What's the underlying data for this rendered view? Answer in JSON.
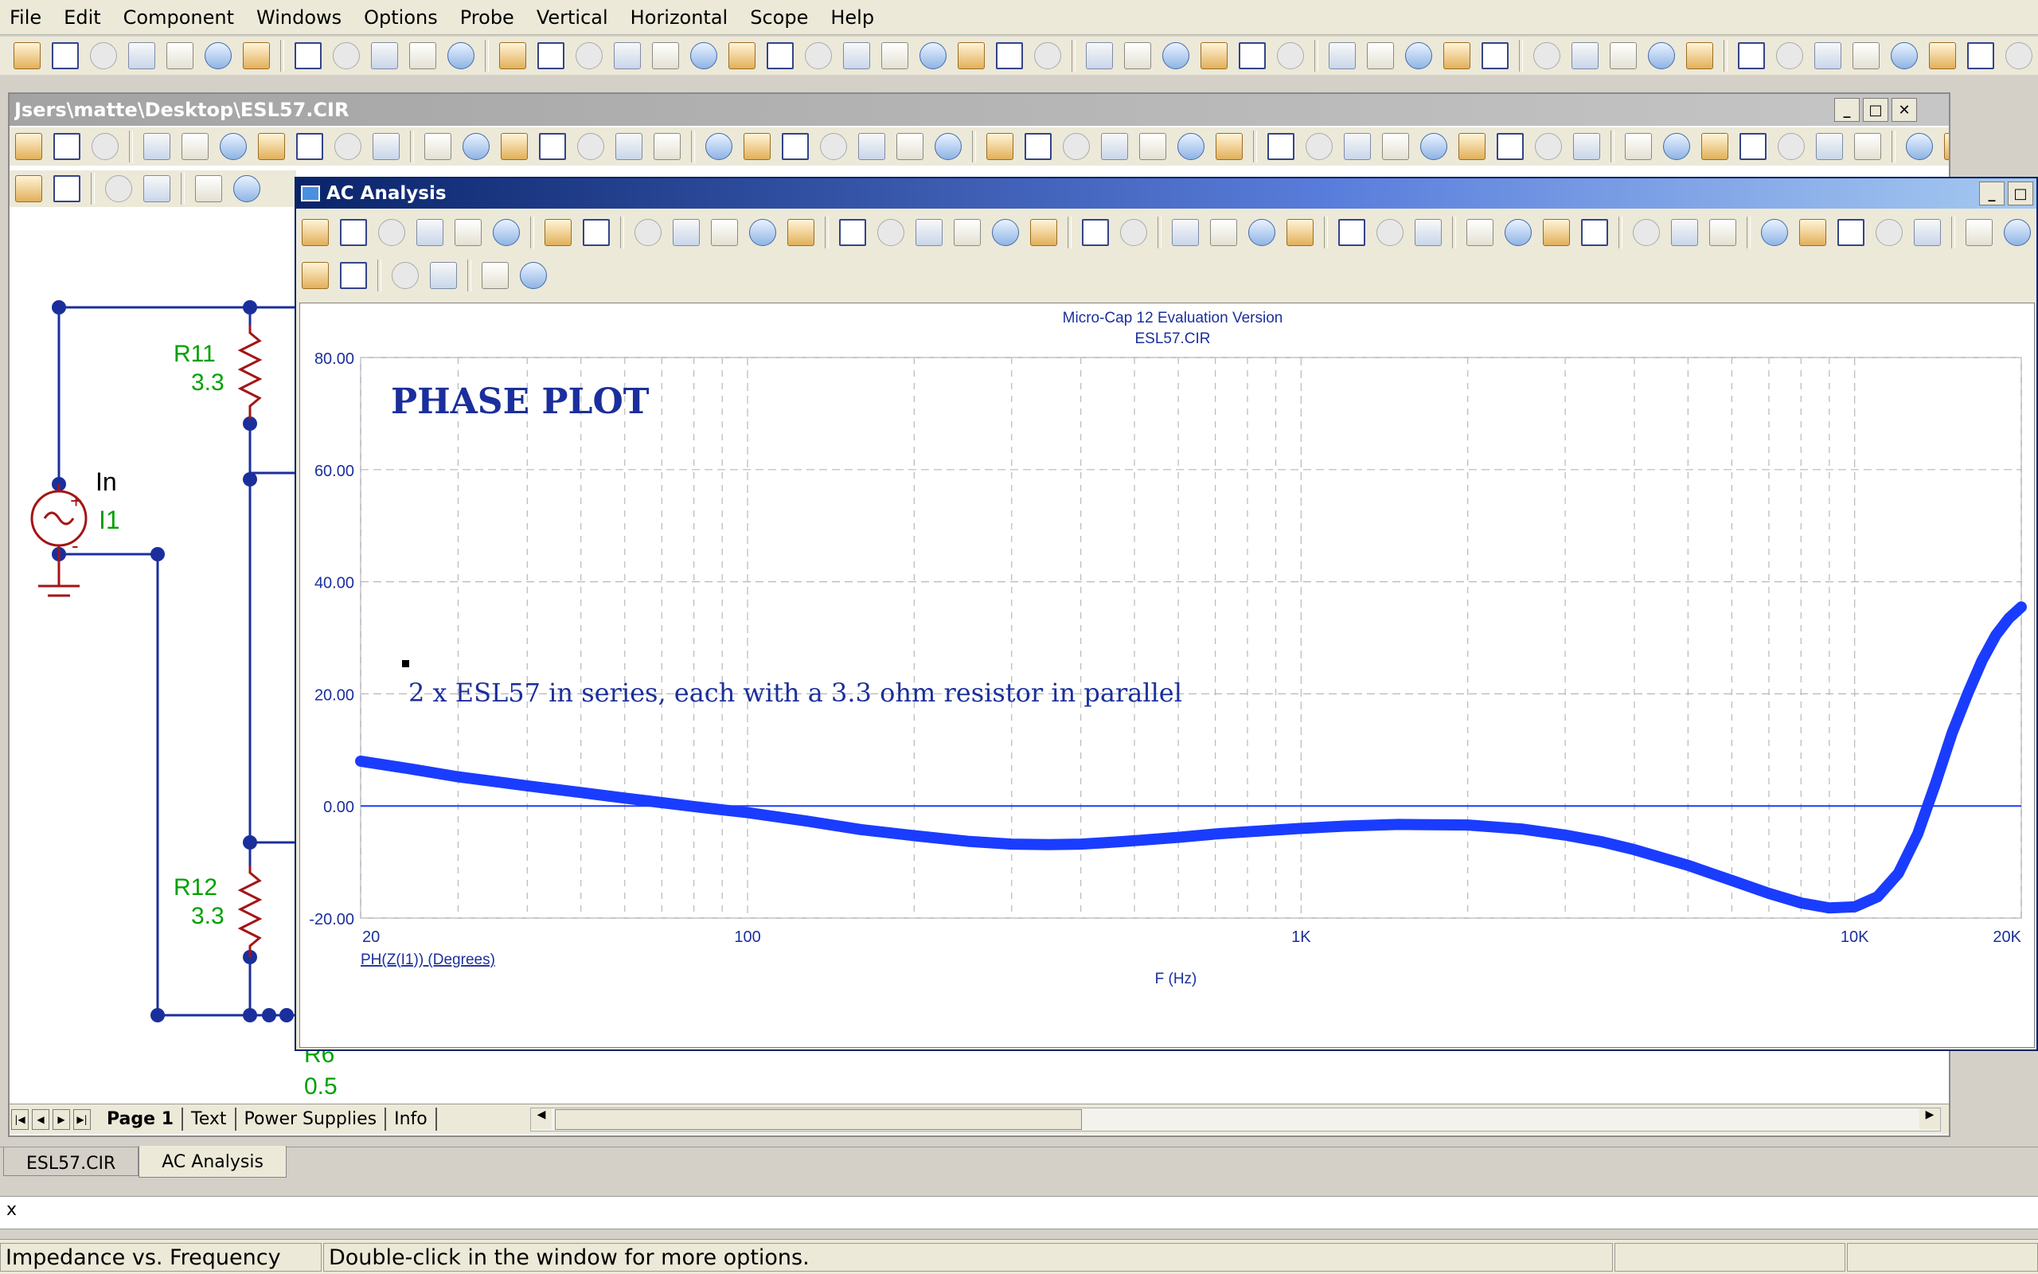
{
  "menu": [
    "File",
    "Edit",
    "Component",
    "Windows",
    "Options",
    "Probe",
    "Vertical",
    "Horizontal",
    "Scope",
    "Help"
  ],
  "schematic": {
    "title": "Jsers\\matte\\Desktop\\ESL57.CIR",
    "components": {
      "r11_name": "R11",
      "r11_value": "3.3",
      "r12_name": "R12",
      "r12_value": "3.3",
      "in_label": "In",
      "source_name": "I1",
      "plus": "+",
      "minus": "-",
      "r_partial_name": "R6",
      "r_partial_value": "0.5"
    },
    "page_tabs": [
      "Page 1",
      "Text",
      "Power Supplies",
      "Info"
    ]
  },
  "ac_window": {
    "title": "AC Analysis",
    "plot": {
      "header_line1": "Micro-Cap 12 Evaluation Version",
      "header_line2": "ESL57.CIR",
      "annotation_title": "PHASE  PLOT",
      "annotation_note": "2 x ESL57 in series, each with a 3.3 ohm resistor in parallel",
      "trace_label": "PH(Z(I1)) (Degrees)",
      "x_axis_label": "F (Hz)"
    }
  },
  "chart_data": {
    "type": "line",
    "title": "Micro-Cap 12 Evaluation Version",
    "subtitle": "ESL57.CIR",
    "xlabel": "F (Hz)",
    "ylabel": "",
    "xscale": "log",
    "xlim": [
      20,
      20000
    ],
    "ylim": [
      -20,
      80
    ],
    "x_tick_labels": [
      "20",
      "100",
      "1K",
      "10K",
      "20K"
    ],
    "y_tick_labels": [
      "80.00",
      "60.00",
      "40.00",
      "20.00",
      "0.00",
      "-20.00"
    ],
    "y_ticks": [
      80,
      60,
      40,
      20,
      0,
      -20
    ],
    "grid": true,
    "series": [
      {
        "name": "PH(Z(I1)) (Degrees)",
        "color": "#1a3cff",
        "x": [
          20,
          25,
          30,
          40,
          50,
          60,
          70,
          80,
          90,
          100,
          130,
          160,
          200,
          250,
          300,
          350,
          400,
          450,
          500,
          600,
          700,
          800,
          1000,
          1200,
          1500,
          2000,
          2500,
          3000,
          3500,
          4000,
          5000,
          6000,
          7000,
          8000,
          9000,
          10000,
          11000,
          12000,
          13000,
          14000,
          15000,
          16000,
          17000,
          18000,
          19000,
          20000
        ],
        "values": [
          8,
          6.5,
          5.2,
          3.6,
          2.4,
          1.4,
          0.6,
          -0.1,
          -0.7,
          -1.2,
          -2.8,
          -4.2,
          -5.3,
          -6.3,
          -6.8,
          -6.9,
          -6.8,
          -6.5,
          -6.2,
          -5.6,
          -5.0,
          -4.6,
          -4.0,
          -3.6,
          -3.3,
          -3.4,
          -4.1,
          -5.2,
          -6.4,
          -7.8,
          -10.6,
          -13.3,
          -15.6,
          -17.3,
          -18.2,
          -18.0,
          -16.2,
          -12.0,
          -5.0,
          4.0,
          13.0,
          20.0,
          26.0,
          30.5,
          33.5,
          35.5
        ]
      }
    ],
    "zero_line_color": "#1a3cff"
  },
  "doc_tabs": [
    "ESL57.CIR",
    "AC Analysis"
  ],
  "command_prefix": "x",
  "status": {
    "left": "Impedance vs. Frequency",
    "middle": "Double-click in the window for more options."
  },
  "colors": {
    "wire": "#1b2f9c",
    "resistor": "#a31515",
    "component_text": "#00a000",
    "plot_text": "#1b2f9c",
    "trace": "#1a3cff"
  }
}
